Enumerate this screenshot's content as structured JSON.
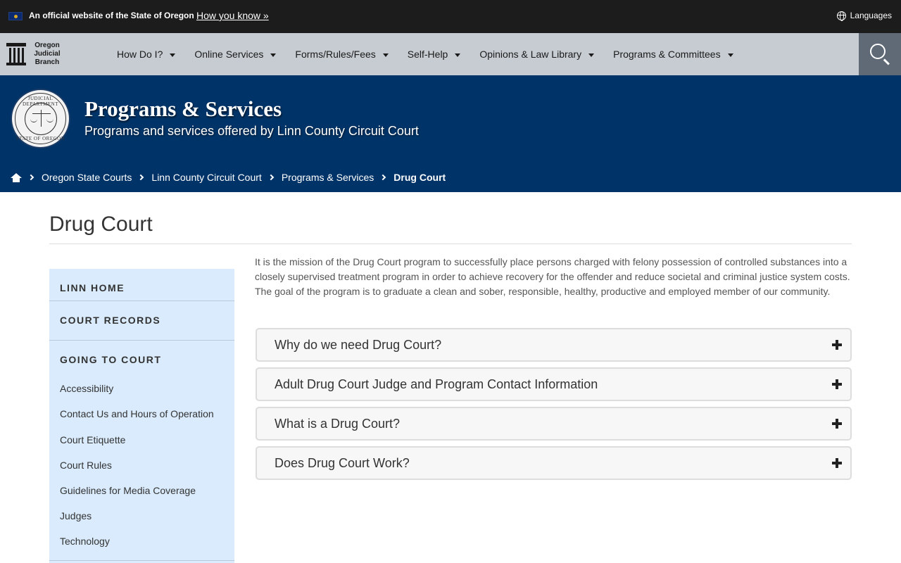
{
  "topbar": {
    "official_text": "An official website of the State of Oregon",
    "how_you_know": "How you know »",
    "languages": "Languages"
  },
  "logo": {
    "line1": "Oregon",
    "line2": "Judicial",
    "line3": "Branch"
  },
  "nav": {
    "items": [
      {
        "label": "How Do I?"
      },
      {
        "label": "Online Services"
      },
      {
        "label": "Forms/Rules/Fees"
      },
      {
        "label": "Self-Help"
      },
      {
        "label": "Opinions & Law Library"
      },
      {
        "label": "Programs & Committees"
      }
    ]
  },
  "hero": {
    "seal_top": "JUDICIAL DEPARTMENT",
    "seal_bottom": "STATE OF OREGON",
    "title": "Programs & Services",
    "subtitle": "Programs and services offered by Linn County Circuit Court"
  },
  "breadcrumb": {
    "items": [
      {
        "label": "Oregon State Courts"
      },
      {
        "label": "Linn County Circuit Court"
      },
      {
        "label": "Programs & Services"
      },
      {
        "label": "Drug Court"
      }
    ]
  },
  "page": {
    "title": "Drug Court"
  },
  "sidebar": {
    "linn_home": "LINN HOME",
    "court_records": "COURT RECORDS",
    "going_to_court": "GOING TO COURT",
    "links": [
      {
        "label": "Accessibility"
      },
      {
        "label": "Contact Us and Hours of Operation"
      },
      {
        "label": "Court Etiquette"
      },
      {
        "label": "Court Rules"
      },
      {
        "label": "Guidelines for Media Coverage"
      },
      {
        "label": "Judges"
      },
      {
        "label": "Technology"
      }
    ]
  },
  "content": {
    "intro": "It is the mission of the Drug Court program to successfully place persons charged with felony possession of controlled substances into a closely supervised treatment program in order to achieve recovery for the offender and reduce societal and criminal justice system costs. The goal of the program is to graduate a clean and sober, responsible, healthy, productive and employed member of our community.",
    "accordion": [
      {
        "label": "Why do we need Drug Court?"
      },
      {
        "label": "Adult Drug Court Judge and Program Contact Information"
      },
      {
        "label": "What is a Drug Court?"
      },
      {
        "label": "Does Drug Court Work?"
      }
    ]
  }
}
